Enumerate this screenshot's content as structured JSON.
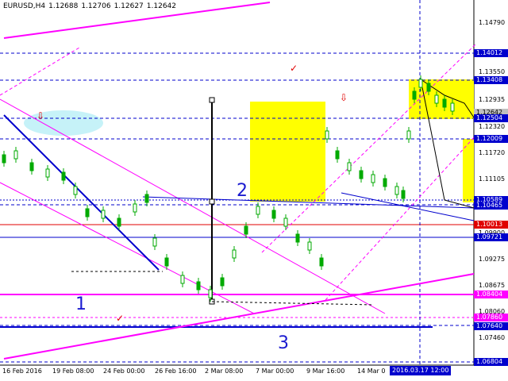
{
  "header": {
    "symbol": "EURUSD,H4",
    "open": "1.12688",
    "high": "1.12706",
    "low": "1.12627",
    "close": "1.12642"
  },
  "price_axis": {
    "labels": [
      "1.14790",
      "1.13550",
      "1.12935",
      "1.12320",
      "1.11720",
      "1.11105",
      "1.09900",
      "1.09275",
      "1.08675",
      "1.08060",
      "1.07460"
    ],
    "tags": [
      {
        "text": "1.14012",
        "color": "#0000cd"
      },
      {
        "text": "1.13408",
        "color": "#0000cd"
      },
      {
        "text": "1.12642",
        "color": "#c0c0c0"
      },
      {
        "text": "1.12504",
        "color": "#0000cd"
      },
      {
        "text": "1.12009",
        "color": "#0000cd"
      },
      {
        "text": "1.10589",
        "color": "#0000cd"
      },
      {
        "text": "1.10465",
        "color": "#0000cd"
      },
      {
        "text": "1.10013",
        "color": "#e00000"
      },
      {
        "text": "1.09721",
        "color": "#0000cd"
      },
      {
        "text": "1.08404",
        "color": "#ff00ff"
      },
      {
        "text": "1.07860",
        "color": "#ff00ff"
      },
      {
        "text": "1.07640",
        "color": "#0000cd"
      },
      {
        "text": "1.06804",
        "color": "#0000cd"
      }
    ]
  },
  "time_axis": {
    "labels": [
      "16 Feb 2016",
      "19 Feb 08:00",
      "24 Feb 00:00",
      "26 Feb 16:00",
      "2 Mar 08:00",
      "7 Mar 00:00",
      "9 Mar 16:00",
      "14 Mar 0"
    ],
    "highlight": "2016.03.17 12:00"
  },
  "wave_labels": [
    "1",
    "2",
    "3"
  ],
  "icons": {
    "check": "✓",
    "arrow_down": "⇩"
  },
  "colors": {
    "trend_blue": "#0000cd",
    "magenta": "#ff00ff",
    "yellow_zone": "#ffff00",
    "cyan_zone": "#b0f0f8",
    "red_level": "#e00000",
    "candles": "#00aa00"
  }
}
